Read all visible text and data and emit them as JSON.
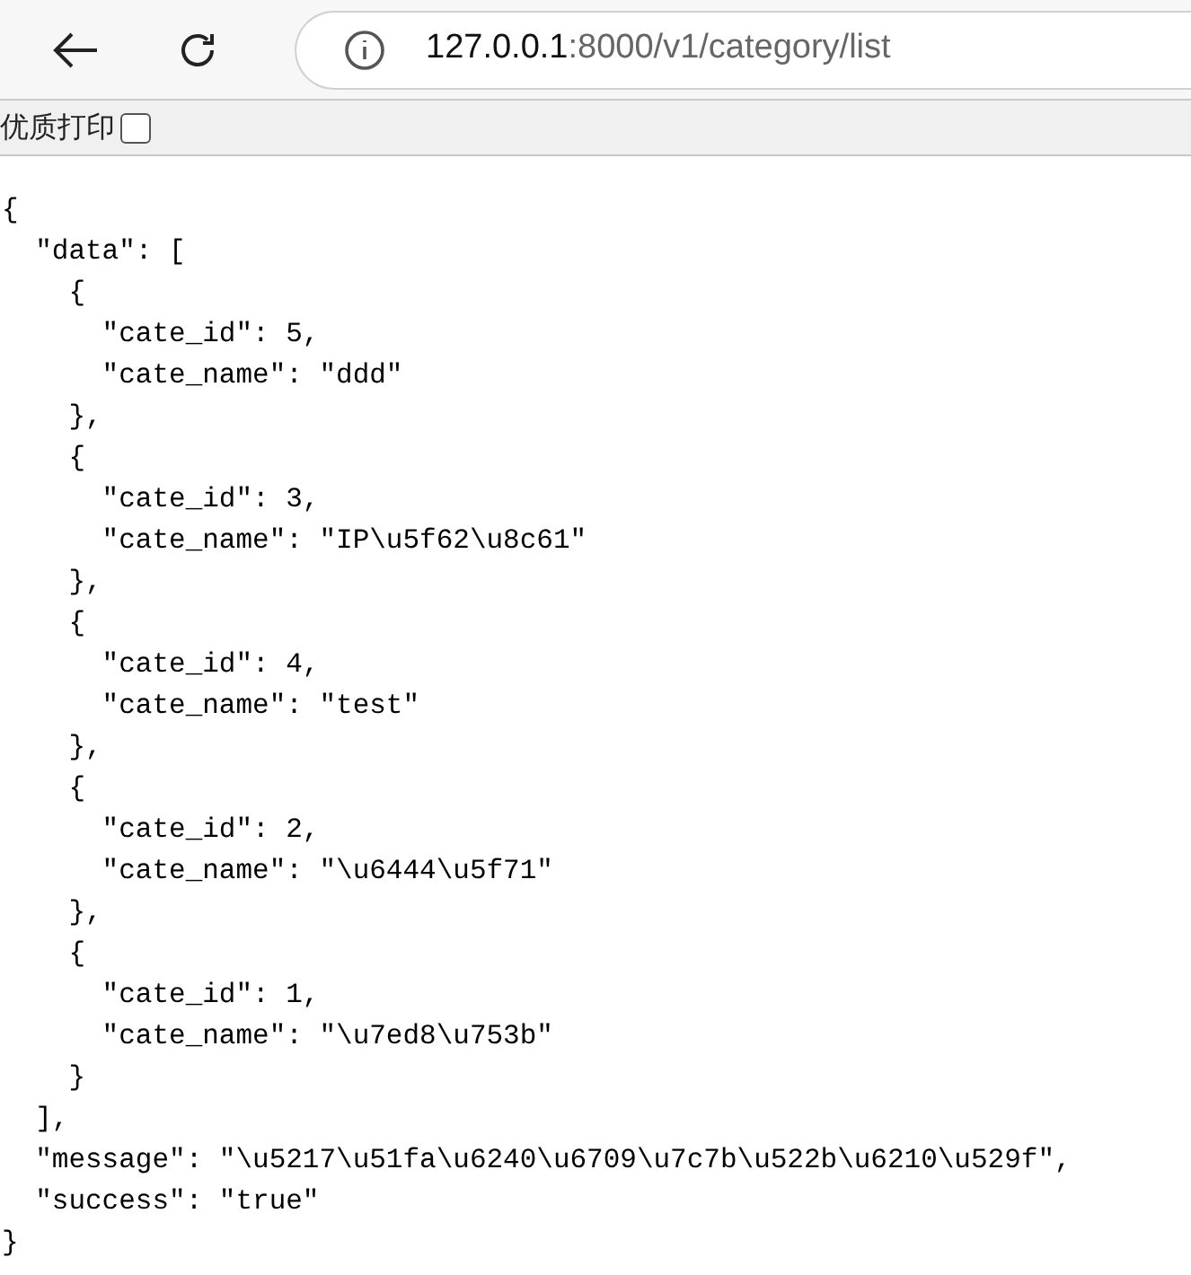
{
  "toolbar": {
    "url_host": "127.0.0.1",
    "url_rest": ":8000/v1/category/list"
  },
  "print_bar": {
    "label": "优质打印",
    "checked": false
  },
  "body_lines": [
    "{",
    "  \"data\": [",
    "    {",
    "      \"cate_id\": 5,",
    "      \"cate_name\": \"ddd\"",
    "    },",
    "    {",
    "      \"cate_id\": 3,",
    "      \"cate_name\": \"IP\\u5f62\\u8c61\"",
    "    },",
    "    {",
    "      \"cate_id\": 4,",
    "      \"cate_name\": \"test\"",
    "    },",
    "    {",
    "      \"cate_id\": 2,",
    "      \"cate_name\": \"\\u6444\\u5f71\"",
    "    },",
    "    {",
    "      \"cate_id\": 1,",
    "      \"cate_name\": \"\\u7ed8\\u753b\"",
    "    }",
    "  ],",
    "  \"message\": \"\\u5217\\u51fa\\u6240\\u6709\\u7c7b\\u522b\\u6210\\u529f\",",
    "  \"success\": \"true\"",
    "}"
  ]
}
